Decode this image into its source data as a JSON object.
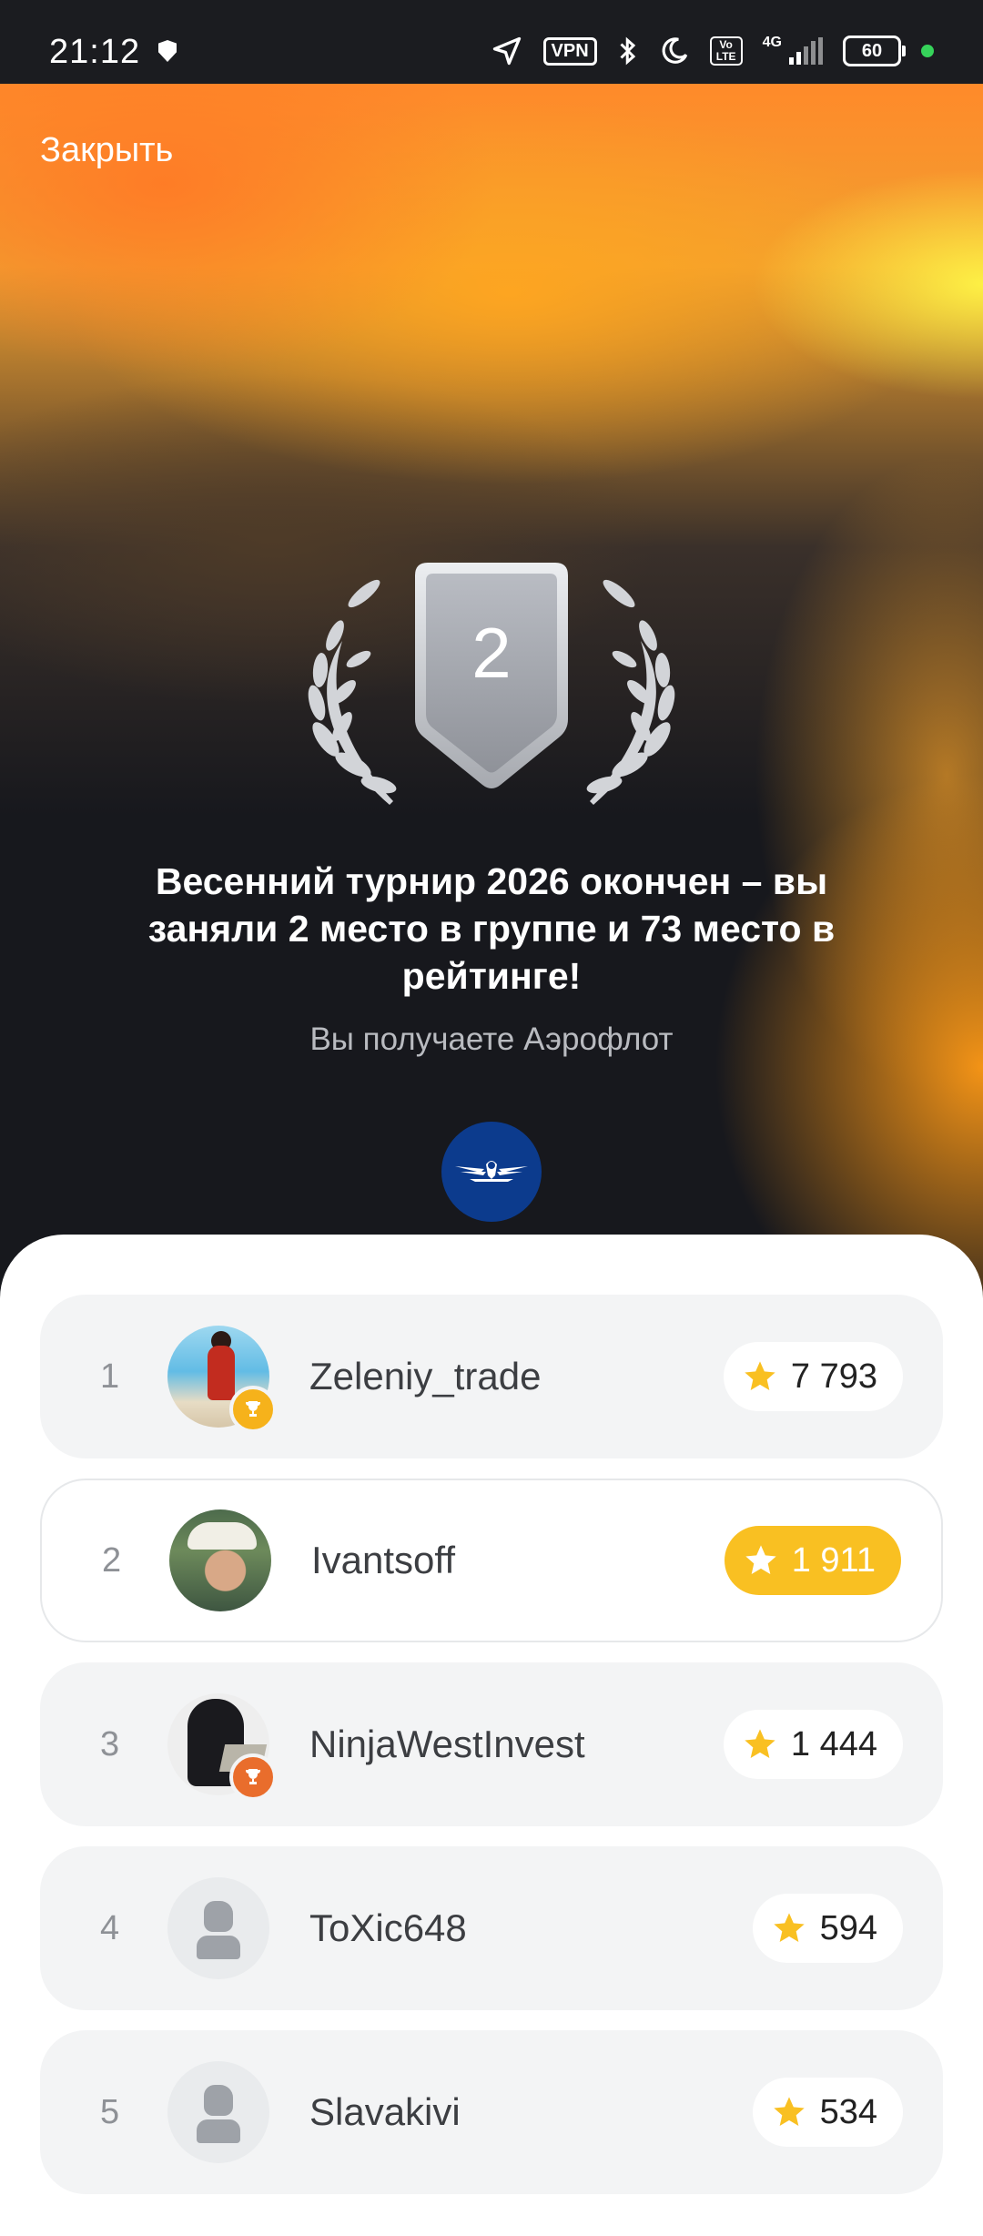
{
  "status_bar": {
    "time": "21:12",
    "vpn": "VPN",
    "volte": "Vo LTE",
    "network": "4G",
    "battery": "60"
  },
  "header": {
    "close_label": "Закрыть"
  },
  "award": {
    "place": "2",
    "title": "Весенний турнир 2026 окончен – вы заняли 2 место в группе и 73 место в рейтинге!",
    "subtitle": "Вы получаете Аэрофлот",
    "prize_logo": "aeroflot-logo"
  },
  "colors": {
    "gold": "#F9C022",
    "bronze": "#E96D2C",
    "aeroflot_blue": "#0C3B8D"
  },
  "leaderboard": [
    {
      "rank": "1",
      "name": "Zeleniy_trade",
      "score": "7 793",
      "badge": "gold-trophy"
    },
    {
      "rank": "2",
      "name": "Ivantsoff",
      "score": "1 911",
      "current_user": true
    },
    {
      "rank": "3",
      "name": "NinjaWestInvest",
      "score": "1 444",
      "badge": "bronze-trophy"
    },
    {
      "rank": "4",
      "name": "ToXic648",
      "score": "594"
    },
    {
      "rank": "5",
      "name": "Slavakivi",
      "score": "534"
    }
  ]
}
